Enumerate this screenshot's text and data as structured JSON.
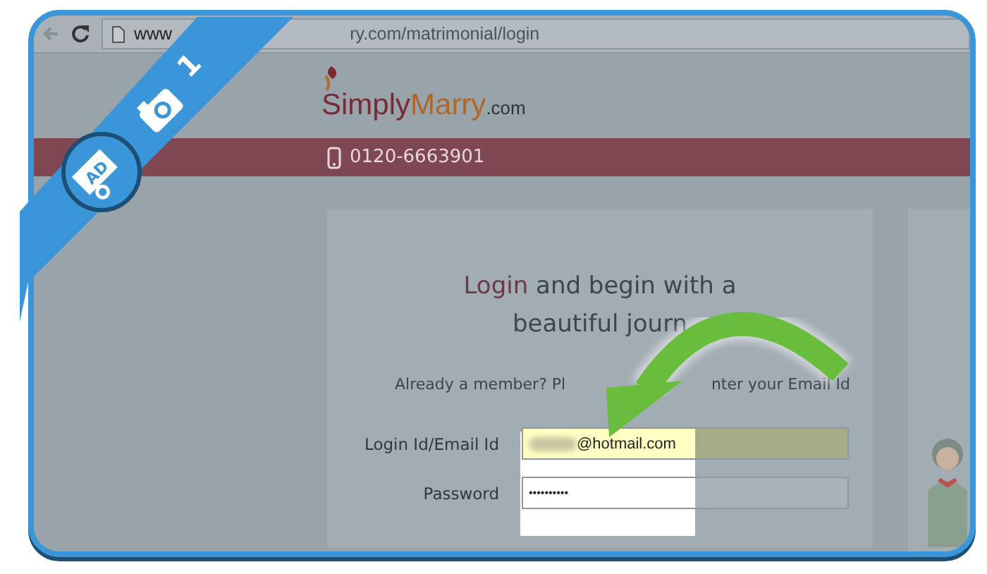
{
  "browser": {
    "url_start": "www",
    "url_end": "ry.com/matrimonial/login"
  },
  "ribbon": {
    "step": "1",
    "badge": "AD"
  },
  "site": {
    "logo_main": "Simply",
    "logo_accent": "Marry",
    "logo_suffix": ".com",
    "phone": "0120-6663901"
  },
  "login": {
    "heading_highlight": "Login",
    "heading_rest": "and begin with a",
    "heading_line2": "beautiful journ",
    "member_start": "Already a member? Pl",
    "member_end": "nter your Email Id",
    "fields": [
      {
        "label": "Login Id/Email Id",
        "value": "@hotmail.com",
        "kind": "email",
        "autofilled": true
      },
      {
        "label": "Password",
        "value": "••••••••••",
        "kind": "password",
        "autofilled": false
      }
    ]
  }
}
